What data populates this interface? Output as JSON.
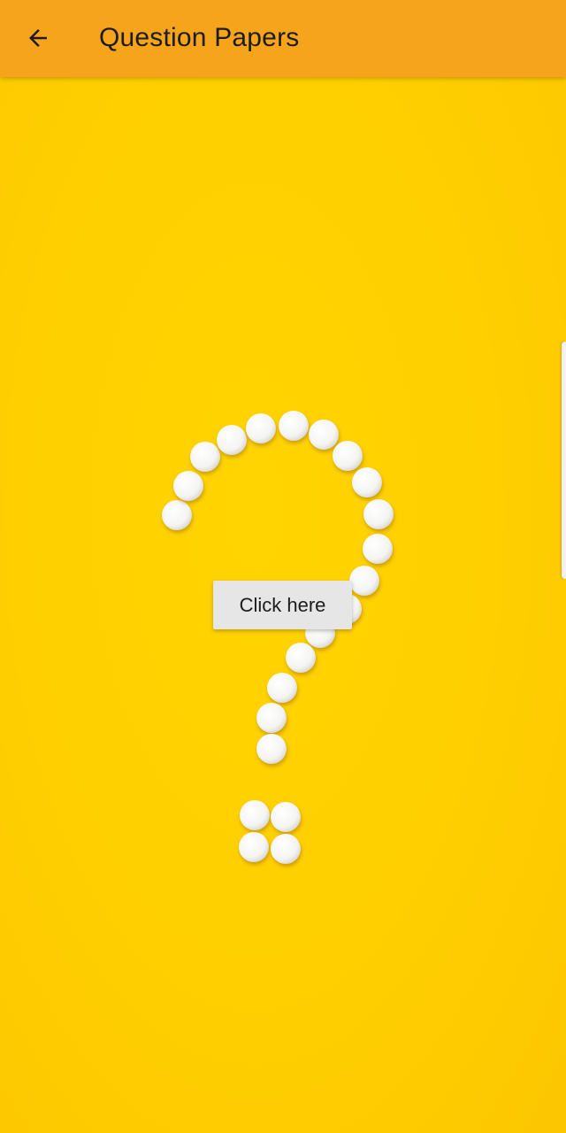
{
  "app_bar": {
    "title": "Question Papers",
    "back_icon": "arrow-left-icon",
    "background": "#f7a41d"
  },
  "hero": {
    "background": "#ffd000",
    "motif": "question-mark-made-of-white-pills"
  },
  "action": {
    "label": "Click here"
  }
}
